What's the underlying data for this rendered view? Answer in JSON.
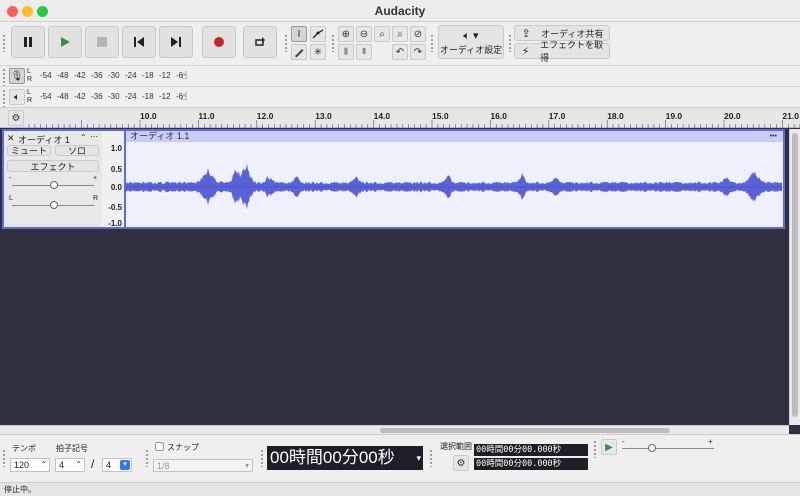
{
  "window": {
    "title": "Audacity"
  },
  "tools": {
    "audio_setup_label": "オーディオ設定",
    "share_audio_label": "オーディオ共有",
    "get_effects_label": "エフェクトを取得"
  },
  "meters": {
    "ticks": [
      "-54",
      "-48",
      "-42",
      "-36",
      "-30",
      "-24",
      "-18",
      "-12",
      "-6"
    ],
    "channel_l": "L",
    "channel_r": "R"
  },
  "ruler": {
    "labels": [
      "10.0",
      "11.0",
      "12.0",
      "13.0",
      "14.0",
      "15.0",
      "16.0",
      "17.0",
      "18.0",
      "19.0",
      "20.0",
      "21.0"
    ]
  },
  "track": {
    "name": "オーディオ 1",
    "mute_label": "ミュート",
    "solo_label": "ソロ",
    "effects_label": "エフェクト",
    "gain_minus": "-",
    "gain_plus": "+",
    "pan_left": "L",
    "pan_right": "R",
    "clip_name": "オーディオ 1.1",
    "scale": [
      "1.0",
      "0.5",
      "0.0",
      "-0.5",
      "-1.0"
    ],
    "menu_dots": "•••"
  },
  "colors": {
    "waveform": "#5a63d6",
    "selection_border": "#5a6be0",
    "background_dark": "#2f3140",
    "record": "#c0262c",
    "play": "#3d8f3d"
  },
  "bottom": {
    "tempo_label": "テンポ",
    "tempo_value": "120",
    "time_sig_label": "拍子記号",
    "time_sig_upper": "4",
    "time_sig_sep": "/",
    "time_sig_lower": "4",
    "snap_label": "スナップ",
    "snap_value": "1/8",
    "time_display": "00時間00分00秒",
    "selection_label": "選択範囲",
    "sel_start": "00時間00分00.000秒",
    "sel_end": "00時間00分00.000秒",
    "speed_minus": "-",
    "speed_plus": "+"
  },
  "status": {
    "text": "停止中。"
  }
}
